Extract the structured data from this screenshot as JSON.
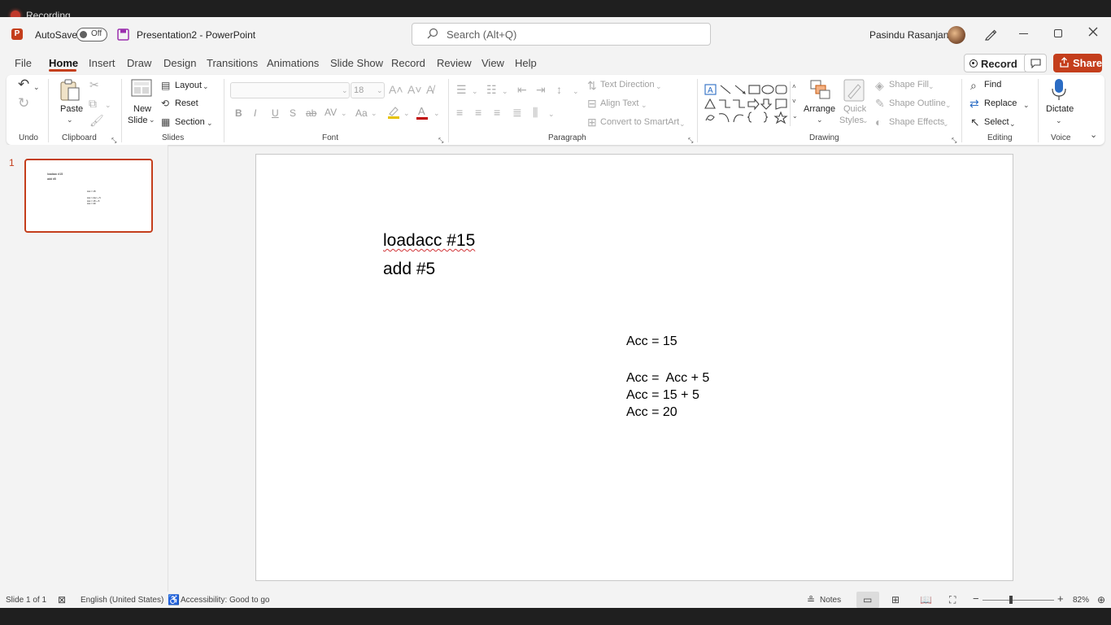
{
  "recording": {
    "label": "Recording"
  },
  "titlebar": {
    "autosave_label": "AutoSave",
    "autosave_state": "Off",
    "doc_title": "Presentation2  -  PowerPoint",
    "search_placeholder": "Search (Alt+Q)",
    "user_name": "Pasindu Rasanjana"
  },
  "tabs": [
    "File",
    "Home",
    "Insert",
    "Draw",
    "Design",
    "Transitions",
    "Animations",
    "Slide Show",
    "Record",
    "Review",
    "View",
    "Help"
  ],
  "active_tab": "Home",
  "actions": {
    "record": "Record",
    "share": "Share"
  },
  "ribbon": {
    "undo": {
      "group": "Undo"
    },
    "clipboard": {
      "group": "Clipboard",
      "paste": "Paste"
    },
    "slides": {
      "group": "Slides",
      "new_slide_1": "New",
      "new_slide_2": "Slide",
      "layout": "Layout",
      "reset": "Reset",
      "section": "Section"
    },
    "font": {
      "group": "Font",
      "font_size": "18",
      "bold": "B",
      "italic": "I",
      "underline": "U",
      "shadow": "S",
      "strike": "ab",
      "spacing": "AV",
      "case": "Aa",
      "font_color": "A"
    },
    "paragraph": {
      "group": "Paragraph",
      "text_direction": "Text Direction",
      "align_text": "Align Text",
      "convert_smartart": "Convert to SmartArt"
    },
    "drawing": {
      "group": "Drawing",
      "arrange": "Arrange",
      "quick_1": "Quick",
      "quick_2": "Styles",
      "shape_fill": "Shape Fill",
      "shape_outline": "Shape Outline",
      "shape_effects": "Shape Effects"
    },
    "editing": {
      "group": "Editing",
      "find": "Find",
      "replace": "Replace",
      "select": "Select"
    },
    "voice": {
      "group": "Voice",
      "dictate": "Dictate"
    }
  },
  "thumbnail": {
    "number": "1"
  },
  "slide": {
    "line1": "loadacc #15",
    "line2": "add #5",
    "acc1": "Acc = 15",
    "acc2": "Acc =  Acc + 5",
    "acc3": "Acc = 15 + 5",
    "acc4": "Acc = 20"
  },
  "status": {
    "slide_count": "Slide 1 of 1",
    "language": "English (United States)",
    "accessibility": "Accessibility: Good to go",
    "notes": "Notes",
    "zoom": "82%"
  },
  "colors": {
    "accent": "#c43e1c",
    "ribbon_bg": "#ffffff",
    "app_bg": "#f3f3f3"
  }
}
